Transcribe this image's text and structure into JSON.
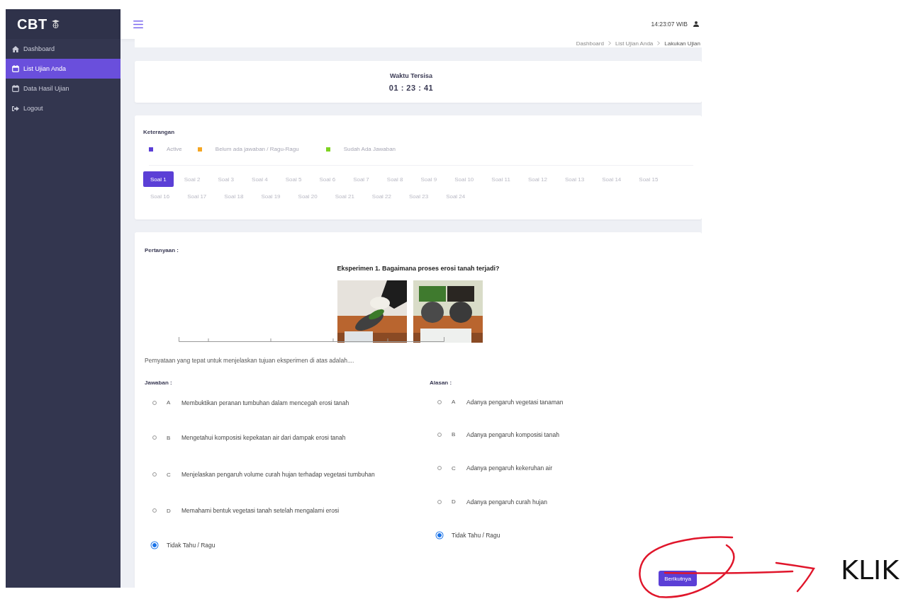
{
  "sidebar": {
    "logo": "CBT",
    "items": [
      {
        "label": "Dashboard",
        "selected": false
      },
      {
        "label": "List Ujian Anda",
        "selected": true
      },
      {
        "label": "Data Hasil Ujian",
        "selected": false
      },
      {
        "label": "Logout",
        "selected": false
      }
    ]
  },
  "header": {
    "clock": "14:23:07",
    "timezone": "WIB"
  },
  "breadcrumb": [
    "Dashboard",
    "List Ujian Anda",
    "Lakukan Ujian"
  ],
  "timer": {
    "title": "Waktu Tersisa",
    "value": "01 : 23 : 41"
  },
  "legend": {
    "title": "Keterangan",
    "items": [
      {
        "label": "Active",
        "color": "#5b3fd6"
      },
      {
        "label": "Belum ada jawaban / Ragu-Ragu",
        "color": "#f5a623"
      },
      {
        "label": "Sudah Ada Jawaban",
        "color": "#7ed321"
      }
    ]
  },
  "questions": [
    {
      "label": "Soal 1",
      "selected": true
    },
    {
      "label": "Soal 2",
      "selected": false
    },
    {
      "label": "Soal 3",
      "selected": false
    },
    {
      "label": "Soal 4",
      "selected": false
    },
    {
      "label": "Soal 5",
      "selected": false
    },
    {
      "label": "Soal 6",
      "selected": false
    },
    {
      "label": "Soal 7",
      "selected": false
    },
    {
      "label": "Soal 8",
      "selected": false
    },
    {
      "label": "Soal 9",
      "selected": false
    },
    {
      "label": "Soal 10",
      "selected": false
    },
    {
      "label": "Soal 11",
      "selected": false
    },
    {
      "label": "Soal 12",
      "selected": false
    },
    {
      "label": "Soal 13",
      "selected": false
    },
    {
      "label": "Soal 14",
      "selected": false
    },
    {
      "label": "Soal 15",
      "selected": false
    },
    {
      "label": "Soal 16",
      "selected": false
    },
    {
      "label": "Soal 17",
      "selected": false
    },
    {
      "label": "Soal 18",
      "selected": false
    },
    {
      "label": "Soal 19",
      "selected": false
    },
    {
      "label": "Soal 20",
      "selected": false
    },
    {
      "label": "Soal 21",
      "selected": false
    },
    {
      "label": "Soal 22",
      "selected": false
    },
    {
      "label": "Soal 23",
      "selected": false
    },
    {
      "label": "Soal 24",
      "selected": false
    }
  ],
  "question": {
    "heading": "Pertanyaan :",
    "title": "Eksperimen 1. Bagaimana proses erosi tanah terjadi?",
    "statement": "Pernyataan yang tepat untuk menjelaskan tujuan eksperimen di atas adalah....",
    "answers": {
      "heading": "Jawaban :",
      "options": [
        {
          "letter": "A",
          "text": "Membuktikan peranan tumbuhan dalam mencegah erosi tanah",
          "selected": false
        },
        {
          "letter": "B",
          "text": "Mengetahui komposisi kepekatan air dari dampak erosi tanah",
          "selected": false
        },
        {
          "letter": "C",
          "text": "Menjelaskan pengaruh volume curah hujan terhadap vegetasi tumbuhan",
          "selected": false
        },
        {
          "letter": "D",
          "text": "Memahami bentuk vegetasi tanah setelah mengalami erosi",
          "selected": false
        },
        {
          "text": "Tidak Tahu / Ragu",
          "selected": true
        }
      ]
    },
    "reasons": {
      "heading": "Alasan :",
      "options": [
        {
          "letter": "A",
          "text": "Adanya pengaruh vegetasi tanaman",
          "selected": false
        },
        {
          "letter": "B",
          "text": "Adanya pengaruh komposisi tanah",
          "selected": false
        },
        {
          "letter": "C",
          "text": "Adanya pengaruh kekeruhan air",
          "selected": false
        },
        {
          "letter": "D",
          "text": "Adanya pengaruh curah hujan",
          "selected": false
        },
        {
          "text": "Tidak Tahu / Ragu",
          "selected": true
        }
      ]
    }
  },
  "next_button": "Berikutnya",
  "annotation": {
    "label": "KLIK"
  }
}
